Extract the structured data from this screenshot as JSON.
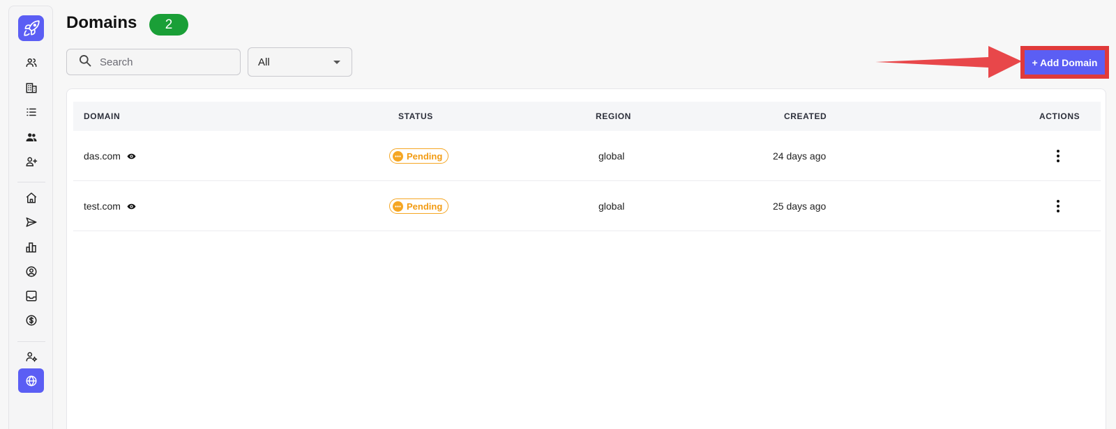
{
  "header": {
    "title": "Domains",
    "count": "2"
  },
  "search": {
    "placeholder": "Search"
  },
  "filter": {
    "selected": "All"
  },
  "toolbar": {
    "add_label": "+ Add Domain"
  },
  "table": {
    "columns": [
      "DOMAIN",
      "STATUS",
      "REGION",
      "CREATED",
      "ACTIONS"
    ],
    "rows": [
      {
        "domain": "das.com",
        "status": "Pending",
        "region": "global",
        "created": "24 days ago"
      },
      {
        "domain": "test.com",
        "status": "Pending",
        "region": "global",
        "created": "25 days ago"
      }
    ]
  },
  "colors": {
    "accent": "#5b5ef4",
    "badge": "#1a9f37",
    "pending": "#f5a623",
    "highlight": "#e03a3a"
  },
  "sidebar": {
    "items": [
      "users-icon",
      "building-icon",
      "list-icon",
      "group-icon",
      "add-user-icon",
      "home-icon",
      "send-icon",
      "chart-icon",
      "profile-icon",
      "inbox-icon",
      "dollar-icon",
      "user-settings-icon",
      "globe-icon"
    ],
    "active": "globe-icon"
  }
}
